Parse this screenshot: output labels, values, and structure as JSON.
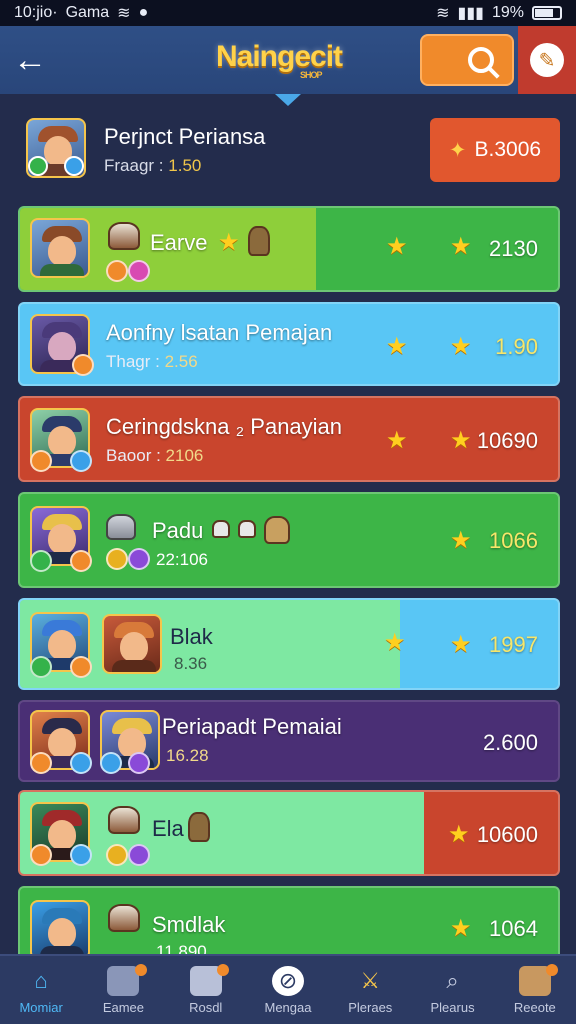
{
  "status_bar": {
    "time": "10:jio·",
    "carrier": "Gama",
    "battery": "19%"
  },
  "header": {
    "logo": "Naingecit",
    "logo_sub": "SHOP"
  },
  "top_card": {
    "name": "Perjnct Periansa",
    "sub_label": "Fraagr :",
    "sub_value": "1.50",
    "price": "B.3006"
  },
  "rows": [
    {
      "title": "Earve",
      "sub_label": "",
      "sub_value": "",
      "value": "2130"
    },
    {
      "title": "Aonfny lsatan Pemajan",
      "sub_label": "Thagr :",
      "sub_value": "2.56",
      "value": "1.90"
    },
    {
      "title": "Ceringdskna ₂ Panayian",
      "sub_label": "Baoor :",
      "sub_value": "2106",
      "value": "10690"
    },
    {
      "title": "Padu",
      "sub_label": "",
      "sub_value": "22:106",
      "value": "1066"
    },
    {
      "title": "Blak",
      "sub_label": "",
      "sub_value": "8.36",
      "value": "1997"
    },
    {
      "title": "Periapadt Pemaiai",
      "sub_label": "",
      "sub_value": "16.28",
      "value": "2.600"
    },
    {
      "title": "Ela",
      "sub_label": "",
      "sub_value": "",
      "value": "10600"
    },
    {
      "title": "Smdlak",
      "sub_label": "",
      "sub_value": "11.890",
      "value": "1064"
    }
  ],
  "nav": [
    {
      "label": "Momiar",
      "icon": "home-icon"
    },
    {
      "label": "Eamee",
      "icon": "cube-icon"
    },
    {
      "label": "Rosdl",
      "icon": "card-icon"
    },
    {
      "label": "Mengaa",
      "icon": "badge-icon"
    },
    {
      "label": "Pleraes",
      "icon": "sword-icon"
    },
    {
      "label": "Plearus",
      "icon": "search-icon"
    },
    {
      "label": "Reeote",
      "icon": "chest-icon"
    }
  ],
  "colors": {
    "bg": "#232c4c",
    "header": "#2f4f86",
    "accent_orange": "#f08a2b",
    "row_green": "#3db547",
    "row_lime": "#8ecf3a",
    "row_blue": "#59c6f5",
    "row_red": "#c9452d",
    "row_purple": "#4a2f75",
    "row_mint": "#7ee8a2"
  }
}
